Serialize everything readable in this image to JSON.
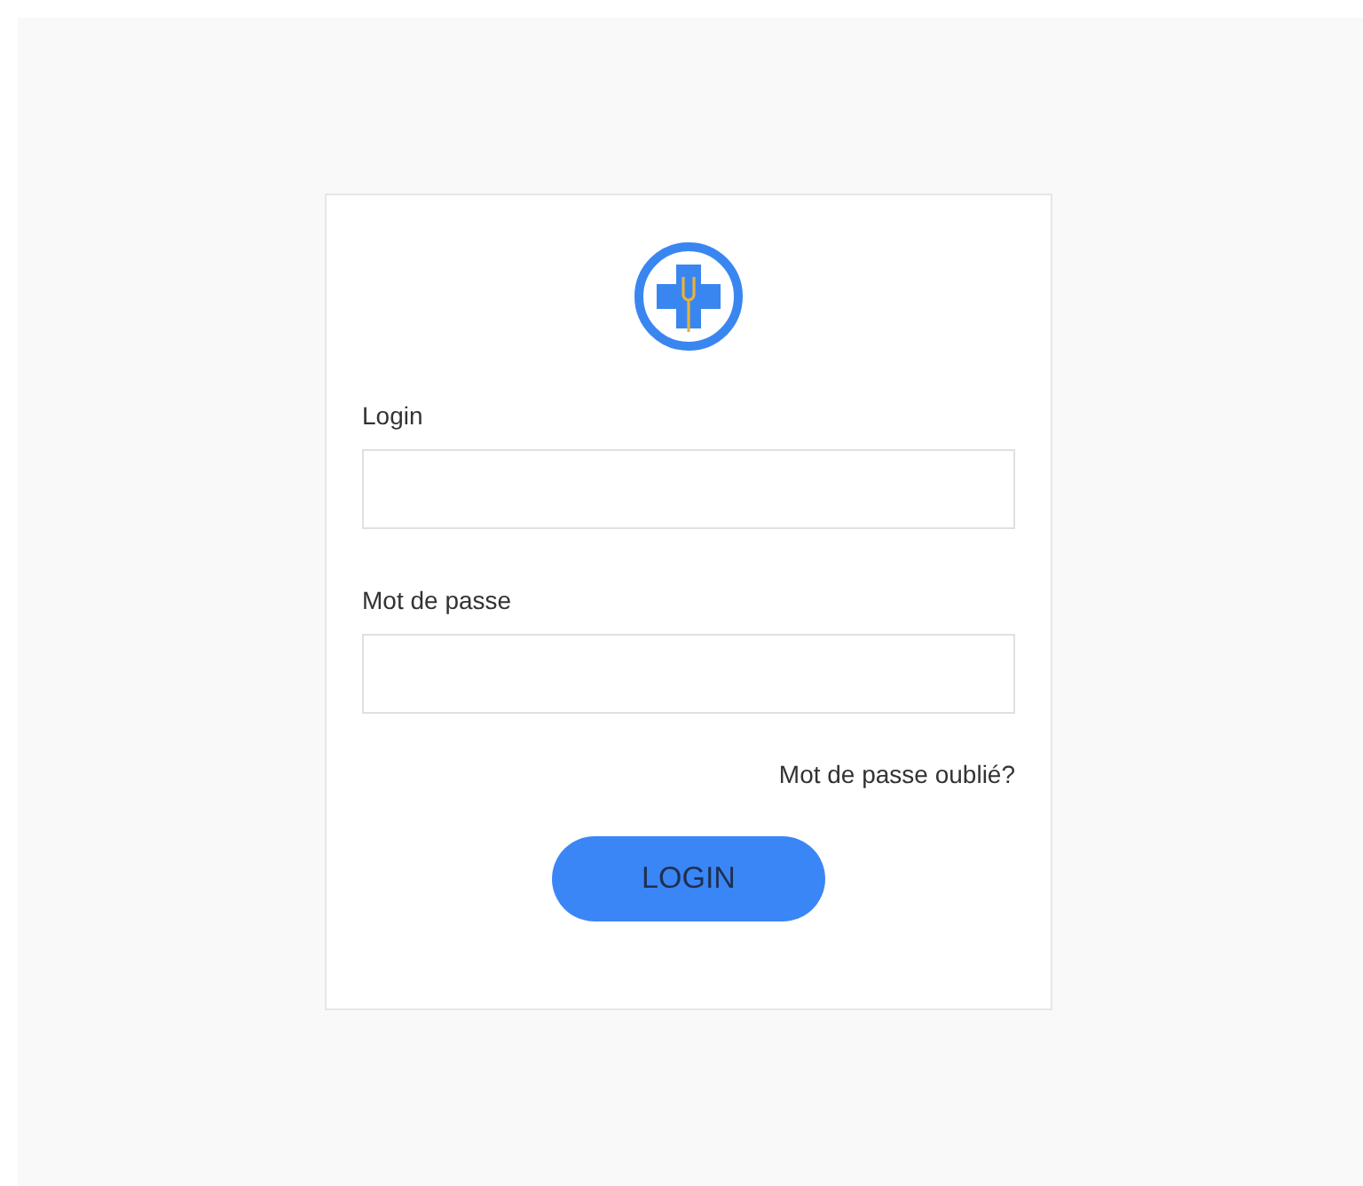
{
  "form": {
    "fields": [
      {
        "label": "Login"
      },
      {
        "label": "Mot de passe"
      }
    ],
    "forgot_link": "Mot de passe oublié?",
    "submit_button": "LOGIN"
  }
}
